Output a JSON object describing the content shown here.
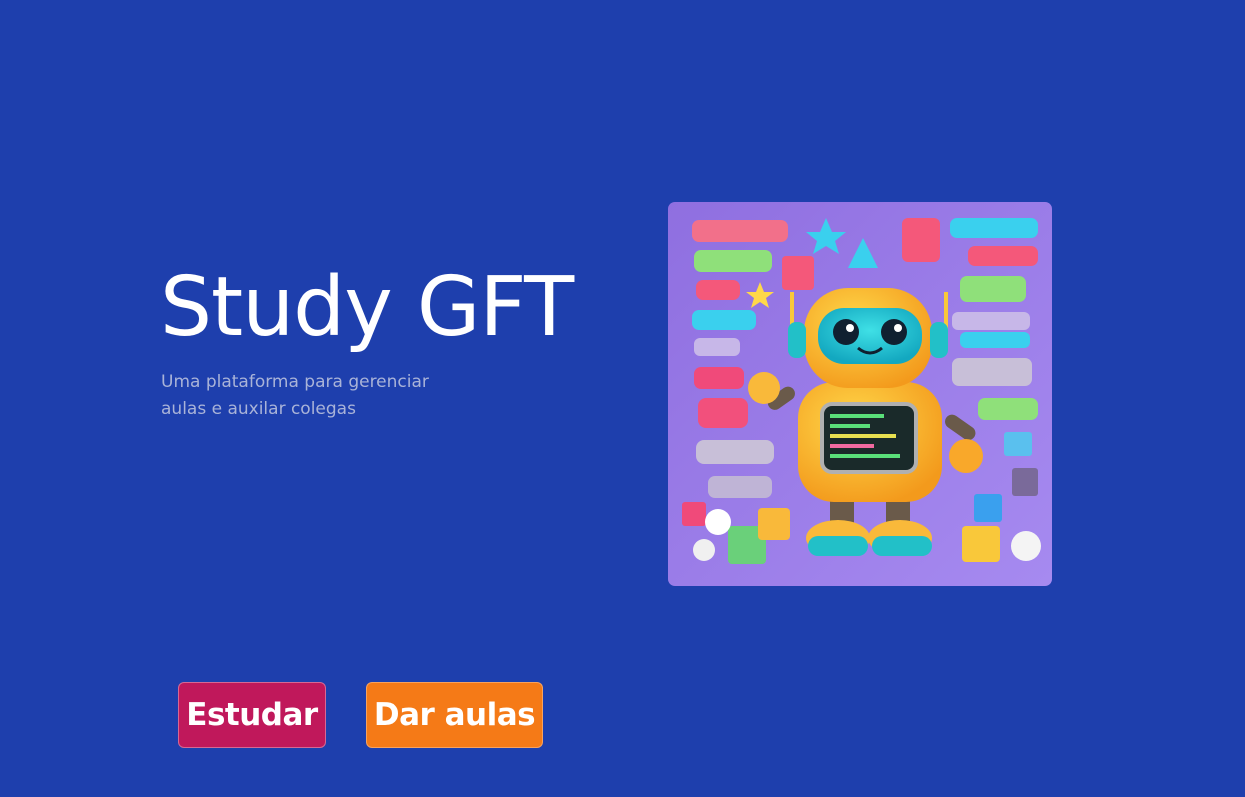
{
  "hero": {
    "title": "Study GFT",
    "subtitle": "Uma plataforma para gerenciar aulas e auxilar colegas"
  },
  "actions": {
    "study_label": "Estudar",
    "teach_label": "Dar aulas"
  },
  "colors": {
    "background": "#1e3fad",
    "study_button": "#c0185b",
    "teach_button": "#f57a17",
    "subtitle_text": "#a9b3d8"
  },
  "illustration": {
    "alt": "robot-coding-illustration"
  }
}
